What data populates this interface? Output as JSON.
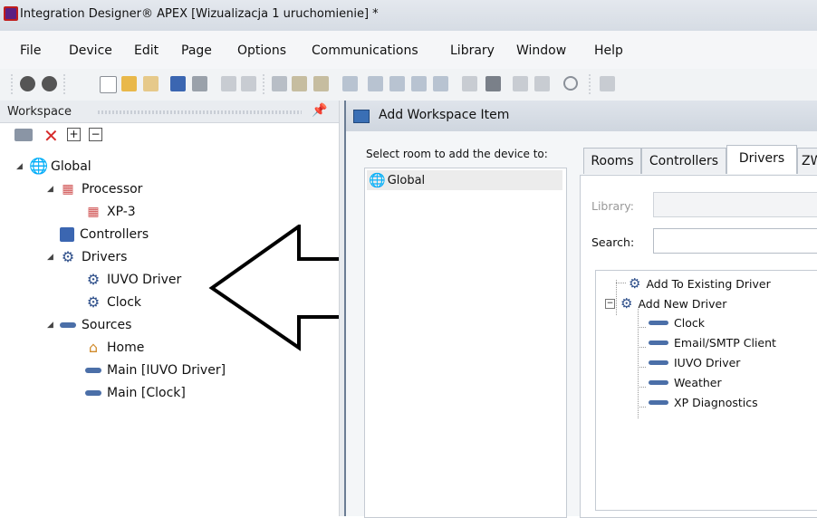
{
  "window": {
    "title": "Integration Designer® APEX [Wizualizacja 1 uruchomienie] *"
  },
  "menu": [
    "File",
    "Device",
    "Edit",
    "Page",
    "Options",
    "Communications",
    "Library",
    "Window",
    "Help"
  ],
  "workspace": {
    "title": "Workspace",
    "tree": {
      "global": "Global",
      "processor": "Processor",
      "xp3": "XP-3",
      "controllers": "Controllers",
      "drivers": "Drivers",
      "iuvo_driver": "IUVO Driver",
      "clock": "Clock",
      "sources": "Sources",
      "home": "Home",
      "main_iuvo": "Main [IUVO Driver]",
      "main_clock": "Main [Clock]"
    }
  },
  "dialog": {
    "title": "Add Workspace Item",
    "select_room_label": "Select room to add the device to:",
    "rooms": [
      "Global"
    ],
    "tabs": [
      "Rooms",
      "Controllers",
      "Drivers",
      "ZW"
    ],
    "active_tab": "Drivers",
    "library_label": "Library:",
    "search_label": "Search:",
    "driver_tree": {
      "add_existing": "Add To Existing Driver",
      "add_new": "Add New Driver",
      "children": [
        "Clock",
        "Email/SMTP Client",
        "IUVO Driver",
        "Weather",
        "XP Diagnostics"
      ]
    }
  }
}
